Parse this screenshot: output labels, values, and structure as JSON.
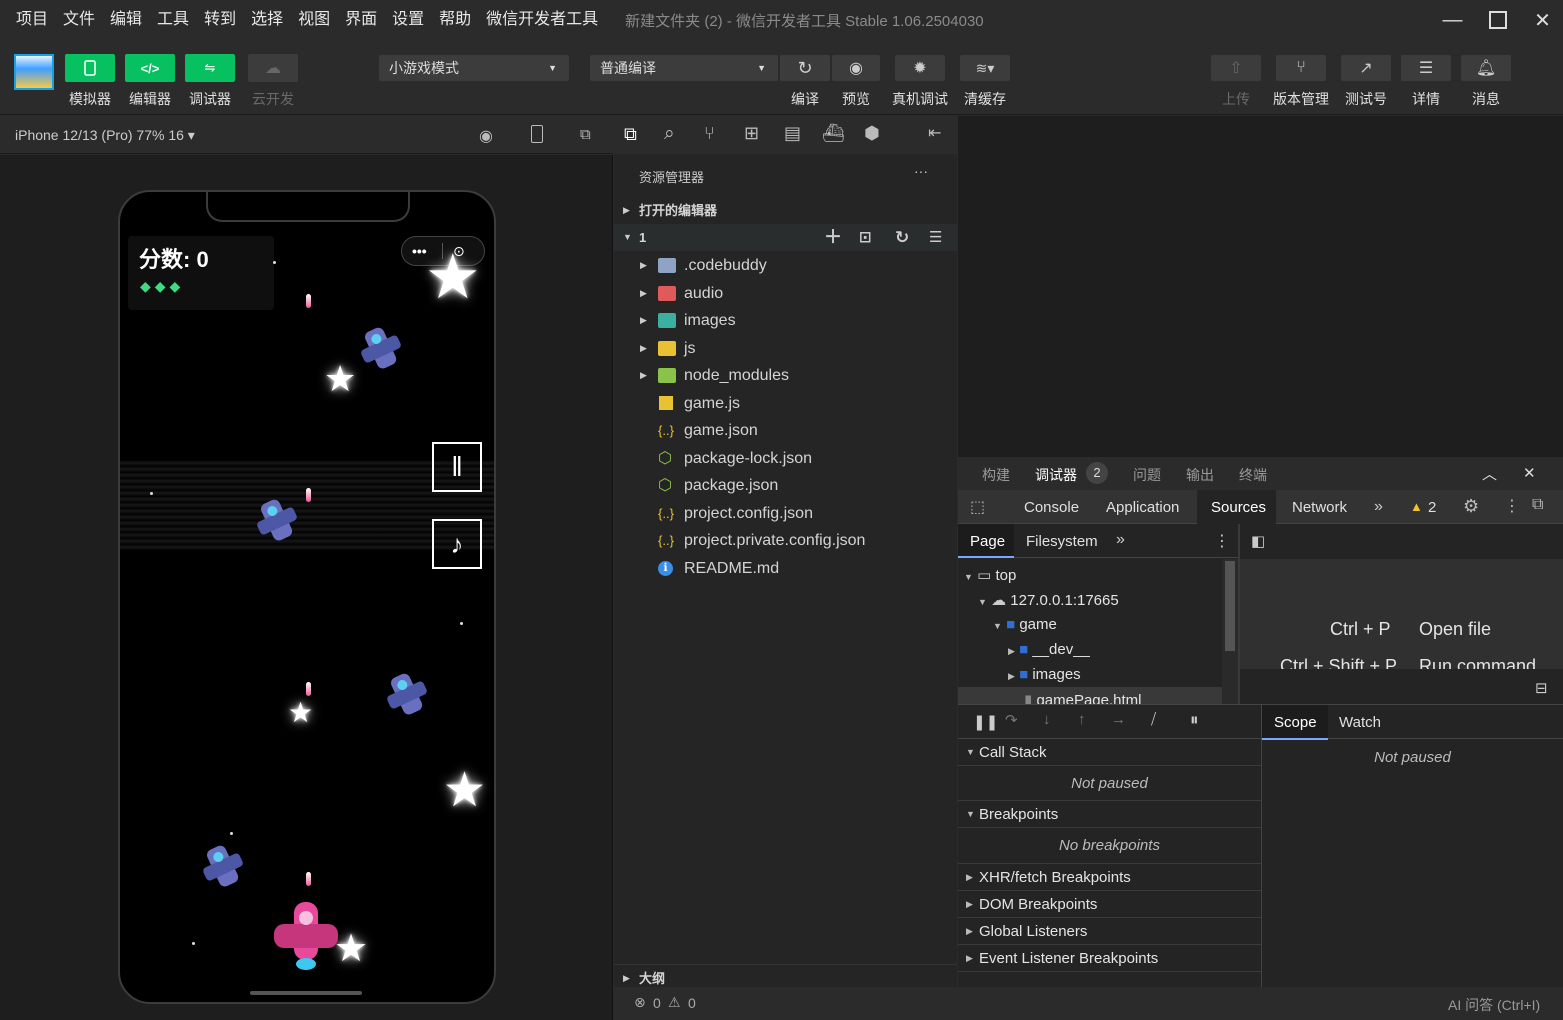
{
  "menu": [
    "项目",
    "文件",
    "编辑",
    "工具",
    "转到",
    "选择",
    "视图",
    "界面",
    "设置",
    "帮助",
    "微信开发者工具"
  ],
  "window_title": "新建文件夹 (2) - 微信开发者工具 Stable 1.06.2504030",
  "toolbar": {
    "simulator": "模拟器",
    "editor": "编辑器",
    "debugger": "调试器",
    "cloud": "云开发",
    "mode_select": "小游戏模式",
    "compile_select": "普通编译",
    "compile": "编译",
    "preview": "预览",
    "real_debug": "真机调试",
    "clear_cache": "清缓存",
    "upload": "上传",
    "version": "版本管理",
    "test_account": "测试号",
    "details": "详情",
    "messages": "消息"
  },
  "simulator": {
    "device": "iPhone 12/13 (Pro) 77% 16 ▾",
    "score": "分数: 0"
  },
  "explorer": {
    "title": "资源管理器",
    "more": "···",
    "open_editors": "打开的编辑器",
    "project": "1",
    "files": [
      {
        "name": ".codebuddy",
        "type": "folder"
      },
      {
        "name": "audio",
        "type": "folder-audio"
      },
      {
        "name": "images",
        "type": "folder-images"
      },
      {
        "name": "js",
        "type": "folder-js"
      },
      {
        "name": "node_modules",
        "type": "folder-node"
      },
      {
        "name": "game.js",
        "type": "js"
      },
      {
        "name": "game.json",
        "type": "json"
      },
      {
        "name": "package-lock.json",
        "type": "npm"
      },
      {
        "name": "package.json",
        "type": "npm"
      },
      {
        "name": "project.config.json",
        "type": "json"
      },
      {
        "name": "project.private.config.json",
        "type": "json"
      },
      {
        "name": "README.md",
        "type": "info"
      }
    ],
    "outline": "大纲"
  },
  "status": {
    "errors": "0",
    "warnings": "0",
    "ai": "AI 问答 (Ctrl+I)"
  },
  "devtools": {
    "panel_tabs": [
      "构建",
      "调试器",
      "问题",
      "输出",
      "终端"
    ],
    "debugger_badge": "2",
    "tabs": [
      "Console",
      "Application",
      "Sources",
      "Network"
    ],
    "warn_count": "2",
    "sub_tabs": [
      "Page",
      "Filesystem"
    ],
    "tree": [
      "top",
      "127.0.0.1:17665",
      "game",
      "__dev__",
      "images",
      "gamePage.html"
    ],
    "shortcuts": [
      {
        "key": "Ctrl + P",
        "action": "Open file"
      },
      {
        "key": "Ctrl + Shift + P",
        "action": "Run command"
      }
    ],
    "scope": "Scope",
    "watch": "Watch",
    "not_paused": "Not paused",
    "call_stack": "Call Stack",
    "breakpoints": "Breakpoints",
    "no_breakpoints": "No breakpoints",
    "xhr": "XHR/fetch Breakpoints",
    "dom": "DOM Breakpoints",
    "global": "Global Listeners",
    "event": "Event Listener Breakpoints"
  },
  "colors": {
    "accent": "#07c160",
    "folder": "#8fa4c4"
  }
}
